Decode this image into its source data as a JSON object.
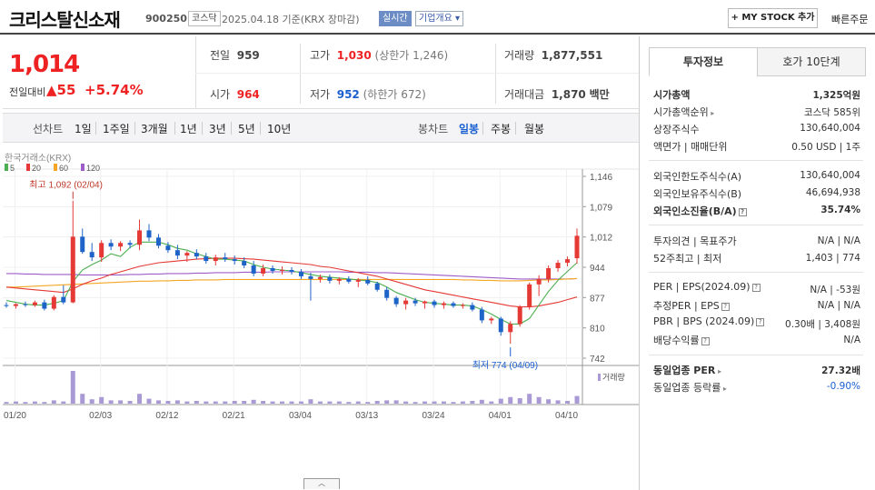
{
  "header": {
    "company_name": "크리스탈신소재",
    "code": "900250",
    "market": "코스닥",
    "date_note": "2025.04.18 기준(KRX 장마감)",
    "live_label": "실시간",
    "info_label": "기업개요",
    "mystock_label": "+ MY STOCK 추가",
    "fast_order_label": "빠른주문"
  },
  "price": {
    "current": "1,014",
    "change_label": "전일대비",
    "change_value": "55",
    "change_pct": "+5.74%",
    "prev_close_label": "전일",
    "prev_close": "959",
    "open_label": "시가",
    "open": "964",
    "high_label": "고가",
    "high": "1,030",
    "upper_limit": "(상한가 1,246)",
    "low_label": "저가",
    "low": "952",
    "lower_limit": "(하한가 672)",
    "volume_label": "거래량",
    "volume": "1,877,551",
    "amount_label": "거래대금",
    "amount": "1,870",
    "amount_unit": "백만"
  },
  "toolbar": {
    "line_chart_label": "선차트",
    "periods": [
      "1일",
      "1주일",
      "3개월",
      "1년",
      "3년",
      "5년",
      "10년"
    ],
    "candle_label": "봉차트",
    "candle_periods": [
      "일봉",
      "주봉",
      "월봉"
    ],
    "active_candle": "일봉"
  },
  "chart_data": {
    "type": "candlestick",
    "source_label": "한국거래소(KRX)",
    "ma_legend": [
      {
        "name": "5",
        "color": "#4caf50"
      },
      {
        "name": "20",
        "color": "#e53935"
      },
      {
        "name": "60",
        "color": "#f5a623"
      },
      {
        "name": "120",
        "color": "#9c5cc9"
      }
    ],
    "y_ticks": [
      "1,146",
      "1,079",
      "1,012",
      "944",
      "877",
      "810",
      "742"
    ],
    "ylim": [
      742,
      1146
    ],
    "x_ticks": [
      "01/20",
      "02/03",
      "02/12",
      "02/21",
      "03/04",
      "03/13",
      "03/24",
      "04/01",
      "04/10"
    ],
    "high_annotation": "최고 1,092 (02/04)",
    "low_annotation": "최저 774 (04/09)",
    "volume_label": "거래량",
    "candles": [
      {
        "o": 860,
        "h": 866,
        "l": 854,
        "c": 858
      },
      {
        "o": 858,
        "h": 864,
        "l": 852,
        "c": 862
      },
      {
        "o": 862,
        "h": 868,
        "l": 856,
        "c": 860
      },
      {
        "o": 860,
        "h": 870,
        "l": 856,
        "c": 866
      },
      {
        "o": 866,
        "h": 872,
        "l": 848,
        "c": 852
      },
      {
        "o": 852,
        "h": 882,
        "l": 848,
        "c": 878
      },
      {
        "o": 878,
        "h": 904,
        "l": 862,
        "c": 866
      },
      {
        "o": 866,
        "h": 1092,
        "l": 864,
        "c": 1012
      },
      {
        "o": 1012,
        "h": 1030,
        "l": 974,
        "c": 978
      },
      {
        "o": 978,
        "h": 998,
        "l": 958,
        "c": 966
      },
      {
        "o": 966,
        "h": 1004,
        "l": 956,
        "c": 998
      },
      {
        "o": 998,
        "h": 1006,
        "l": 982,
        "c": 990
      },
      {
        "o": 990,
        "h": 1002,
        "l": 980,
        "c": 998
      },
      {
        "o": 998,
        "h": 1004,
        "l": 986,
        "c": 994
      },
      {
        "o": 994,
        "h": 1050,
        "l": 982,
        "c": 1026
      },
      {
        "o": 1026,
        "h": 1040,
        "l": 1002,
        "c": 1010
      },
      {
        "o": 1010,
        "h": 1018,
        "l": 986,
        "c": 992
      },
      {
        "o": 992,
        "h": 1000,
        "l": 976,
        "c": 982
      },
      {
        "o": 982,
        "h": 994,
        "l": 962,
        "c": 970
      },
      {
        "o": 970,
        "h": 980,
        "l": 956,
        "c": 976
      },
      {
        "o": 976,
        "h": 984,
        "l": 962,
        "c": 968
      },
      {
        "o": 968,
        "h": 976,
        "l": 952,
        "c": 958
      },
      {
        "o": 958,
        "h": 972,
        "l": 948,
        "c": 966
      },
      {
        "o": 966,
        "h": 976,
        "l": 956,
        "c": 962
      },
      {
        "o": 962,
        "h": 970,
        "l": 950,
        "c": 958
      },
      {
        "o": 958,
        "h": 966,
        "l": 942,
        "c": 948
      },
      {
        "o": 948,
        "h": 958,
        "l": 924,
        "c": 930
      },
      {
        "o": 930,
        "h": 950,
        "l": 924,
        "c": 942
      },
      {
        "o": 942,
        "h": 948,
        "l": 930,
        "c": 936
      },
      {
        "o": 936,
        "h": 946,
        "l": 928,
        "c": 938
      },
      {
        "o": 938,
        "h": 944,
        "l": 928,
        "c": 934
      },
      {
        "o": 934,
        "h": 940,
        "l": 918,
        "c": 924
      },
      {
        "o": 924,
        "h": 932,
        "l": 870,
        "c": 918
      },
      {
        "o": 918,
        "h": 928,
        "l": 910,
        "c": 922
      },
      {
        "o": 922,
        "h": 928,
        "l": 908,
        "c": 914
      },
      {
        "o": 914,
        "h": 922,
        "l": 906,
        "c": 918
      },
      {
        "o": 918,
        "h": 924,
        "l": 908,
        "c": 912
      },
      {
        "o": 912,
        "h": 920,
        "l": 900,
        "c": 916
      },
      {
        "o": 916,
        "h": 924,
        "l": 904,
        "c": 908
      },
      {
        "o": 908,
        "h": 912,
        "l": 890,
        "c": 894
      },
      {
        "o": 894,
        "h": 900,
        "l": 870,
        "c": 876
      },
      {
        "o": 876,
        "h": 880,
        "l": 856,
        "c": 862
      },
      {
        "o": 862,
        "h": 876,
        "l": 850,
        "c": 870
      },
      {
        "o": 870,
        "h": 876,
        "l": 858,
        "c": 864
      },
      {
        "o": 864,
        "h": 870,
        "l": 852,
        "c": 868
      },
      {
        "o": 868,
        "h": 872,
        "l": 854,
        "c": 860
      },
      {
        "o": 860,
        "h": 868,
        "l": 852,
        "c": 864
      },
      {
        "o": 864,
        "h": 868,
        "l": 854,
        "c": 858
      },
      {
        "o": 858,
        "h": 864,
        "l": 852,
        "c": 860
      },
      {
        "o": 860,
        "h": 866,
        "l": 846,
        "c": 850
      },
      {
        "o": 850,
        "h": 856,
        "l": 820,
        "c": 826
      },
      {
        "o": 826,
        "h": 834,
        "l": 818,
        "c": 830
      },
      {
        "o": 830,
        "h": 834,
        "l": 792,
        "c": 800
      },
      {
        "o": 800,
        "h": 824,
        "l": 774,
        "c": 818
      },
      {
        "o": 818,
        "h": 860,
        "l": 812,
        "c": 856
      },
      {
        "o": 856,
        "h": 910,
        "l": 850,
        "c": 906
      },
      {
        "o": 906,
        "h": 926,
        "l": 880,
        "c": 918
      },
      {
        "o": 918,
        "h": 948,
        "l": 910,
        "c": 942
      },
      {
        "o": 942,
        "h": 960,
        "l": 934,
        "c": 954
      },
      {
        "o": 954,
        "h": 968,
        "l": 946,
        "c": 962
      },
      {
        "o": 964,
        "h": 1030,
        "l": 952,
        "c": 1014
      }
    ],
    "volumes": [
      3,
      4,
      3,
      4,
      3,
      6,
      4,
      60,
      18,
      8,
      12,
      6,
      6,
      5,
      18,
      9,
      6,
      5,
      6,
      4,
      5,
      4,
      4,
      4,
      5,
      5,
      7,
      5,
      4,
      4,
      4,
      4,
      8,
      4,
      4,
      4,
      3,
      4,
      3,
      5,
      6,
      6,
      4,
      3,
      4,
      4,
      4,
      3,
      4,
      5,
      7,
      4,
      9,
      12,
      10,
      18,
      12,
      8,
      6,
      5,
      14
    ],
    "ma5": [
      870,
      866,
      862,
      860,
      860,
      864,
      870,
      912,
      938,
      950,
      960,
      974,
      968,
      988,
      1000,
      1000,
      1000,
      994,
      986,
      982,
      974,
      968,
      962,
      962,
      960,
      958,
      950,
      944,
      940,
      938,
      936,
      932,
      928,
      924,
      922,
      920,
      918,
      916,
      914,
      910,
      900,
      888,
      880,
      872,
      866,
      864,
      862,
      860,
      860,
      858,
      850,
      840,
      828,
      818,
      818,
      830,
      860,
      890,
      915,
      935,
      954
    ],
    "ma20": [
      900,
      898,
      896,
      894,
      892,
      890,
      888,
      896,
      906,
      914,
      920,
      928,
      934,
      940,
      946,
      950,
      954,
      956,
      958,
      960,
      962,
      963,
      964,
      964,
      964,
      963,
      962,
      960,
      958,
      956,
      954,
      952,
      950,
      946,
      944,
      940,
      936,
      932,
      928,
      924,
      918,
      912,
      906,
      900,
      894,
      890,
      886,
      882,
      878,
      874,
      870,
      866,
      862,
      858,
      856,
      856,
      858,
      862,
      866,
      872,
      878
    ],
    "ma60": [
      900,
      900,
      901,
      902,
      903,
      904,
      905,
      906,
      907,
      908,
      909,
      910,
      911,
      912,
      913,
      913,
      914,
      914,
      915,
      915,
      916,
      916,
      916,
      917,
      917,
      917,
      917,
      917,
      917,
      917,
      917,
      917,
      917,
      917,
      917,
      917,
      917,
      917,
      917,
      917,
      917,
      917,
      917,
      917,
      917,
      917,
      917,
      917,
      916,
      916,
      915,
      915,
      914,
      914,
      914,
      915,
      916,
      916,
      917,
      918,
      919
    ],
    "ma120": [
      930,
      930,
      929,
      929,
      928,
      928,
      928,
      928,
      927,
      927,
      927,
      927,
      927,
      928,
      928,
      929,
      929,
      930,
      930,
      930,
      931,
      931,
      932,
      932,
      932,
      933,
      933,
      933,
      934,
      934,
      934,
      934,
      934,
      934,
      934,
      934,
      933,
      933,
      933,
      932,
      932,
      931,
      930,
      929,
      928,
      927,
      926,
      925,
      924,
      923,
      922,
      921,
      920,
      919,
      918,
      918,
      918,
      918,
      918,
      918,
      919
    ]
  },
  "right_panel": {
    "tab_info": "투자정보",
    "tab_orderbook": "호가 10단계",
    "market_cap_label": "시가총액",
    "market_cap": "1,325억원",
    "cap_rank_label": "시가총액순위",
    "cap_rank": "코스닥 585위",
    "shares_label": "상장주식수",
    "shares": "130,640,004",
    "par_label": "액면가 | 매매단위",
    "par": "0.50 USD | 1주",
    "foreign_limit_label": "외국인한도주식수(A)",
    "foreign_limit": "130,640,004",
    "foreign_hold_label": "외국인보유주식수(B)",
    "foreign_hold": "46,694,938",
    "foreign_ratio_label": "외국인소진율(B/A)",
    "foreign_ratio": "35.74%",
    "opinion_label": "투자의견 | 목표주가",
    "opinion": "N/A | N/A",
    "w52_label": "52주최고 | 최저",
    "w52": "1,403 | 774",
    "per_label": "PER | EPS(2024.09)",
    "per": "N/A | -53원",
    "est_per_label": "추정PER | EPS",
    "est_per": "N/A | N/A",
    "pbr_label": "PBR | BPS (2024.09)",
    "pbr": "0.30배 | 3,408원",
    "div_label": "배당수익률",
    "div": "N/A",
    "sector_per_label": "동일업종 PER",
    "sector_per": "27.32배",
    "sector_chg_label": "동일업종 등락률",
    "sector_chg": "-0.90%"
  }
}
